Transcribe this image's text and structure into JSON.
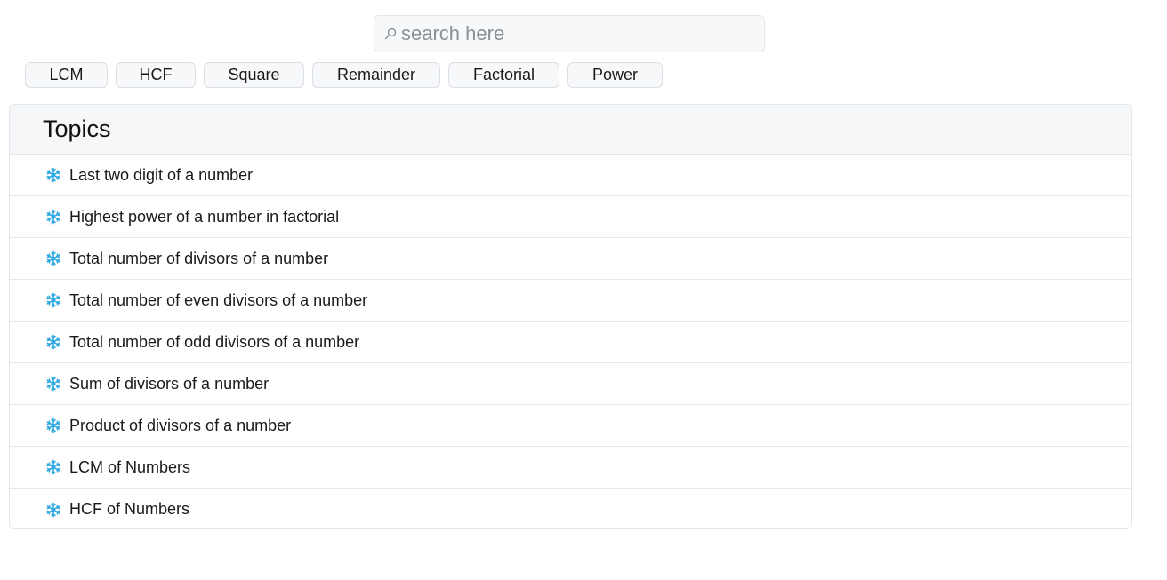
{
  "search": {
    "placeholder": "search here",
    "icon": "search-icon"
  },
  "filters": [
    {
      "label": "LCM"
    },
    {
      "label": "HCF"
    },
    {
      "label": "Square"
    },
    {
      "label": "Remainder"
    },
    {
      "label": "Factorial"
    },
    {
      "label": "Power"
    }
  ],
  "panel": {
    "title": "Topics",
    "item_icon": "snowflake-icon",
    "item_icon_color": "#2aa7e0",
    "items": [
      {
        "label": "Last two digit of a number"
      },
      {
        "label": "Highest power of a number in factorial"
      },
      {
        "label": "Total number of divisors of a number"
      },
      {
        "label": "Total number of even divisors of a number"
      },
      {
        "label": "Total number of odd divisors of a number"
      },
      {
        "label": "Sum of divisors of a number"
      },
      {
        "label": "Product of divisors of a number"
      },
      {
        "label": "LCM of Numbers"
      },
      {
        "label": "HCF of Numbers"
      }
    ]
  }
}
